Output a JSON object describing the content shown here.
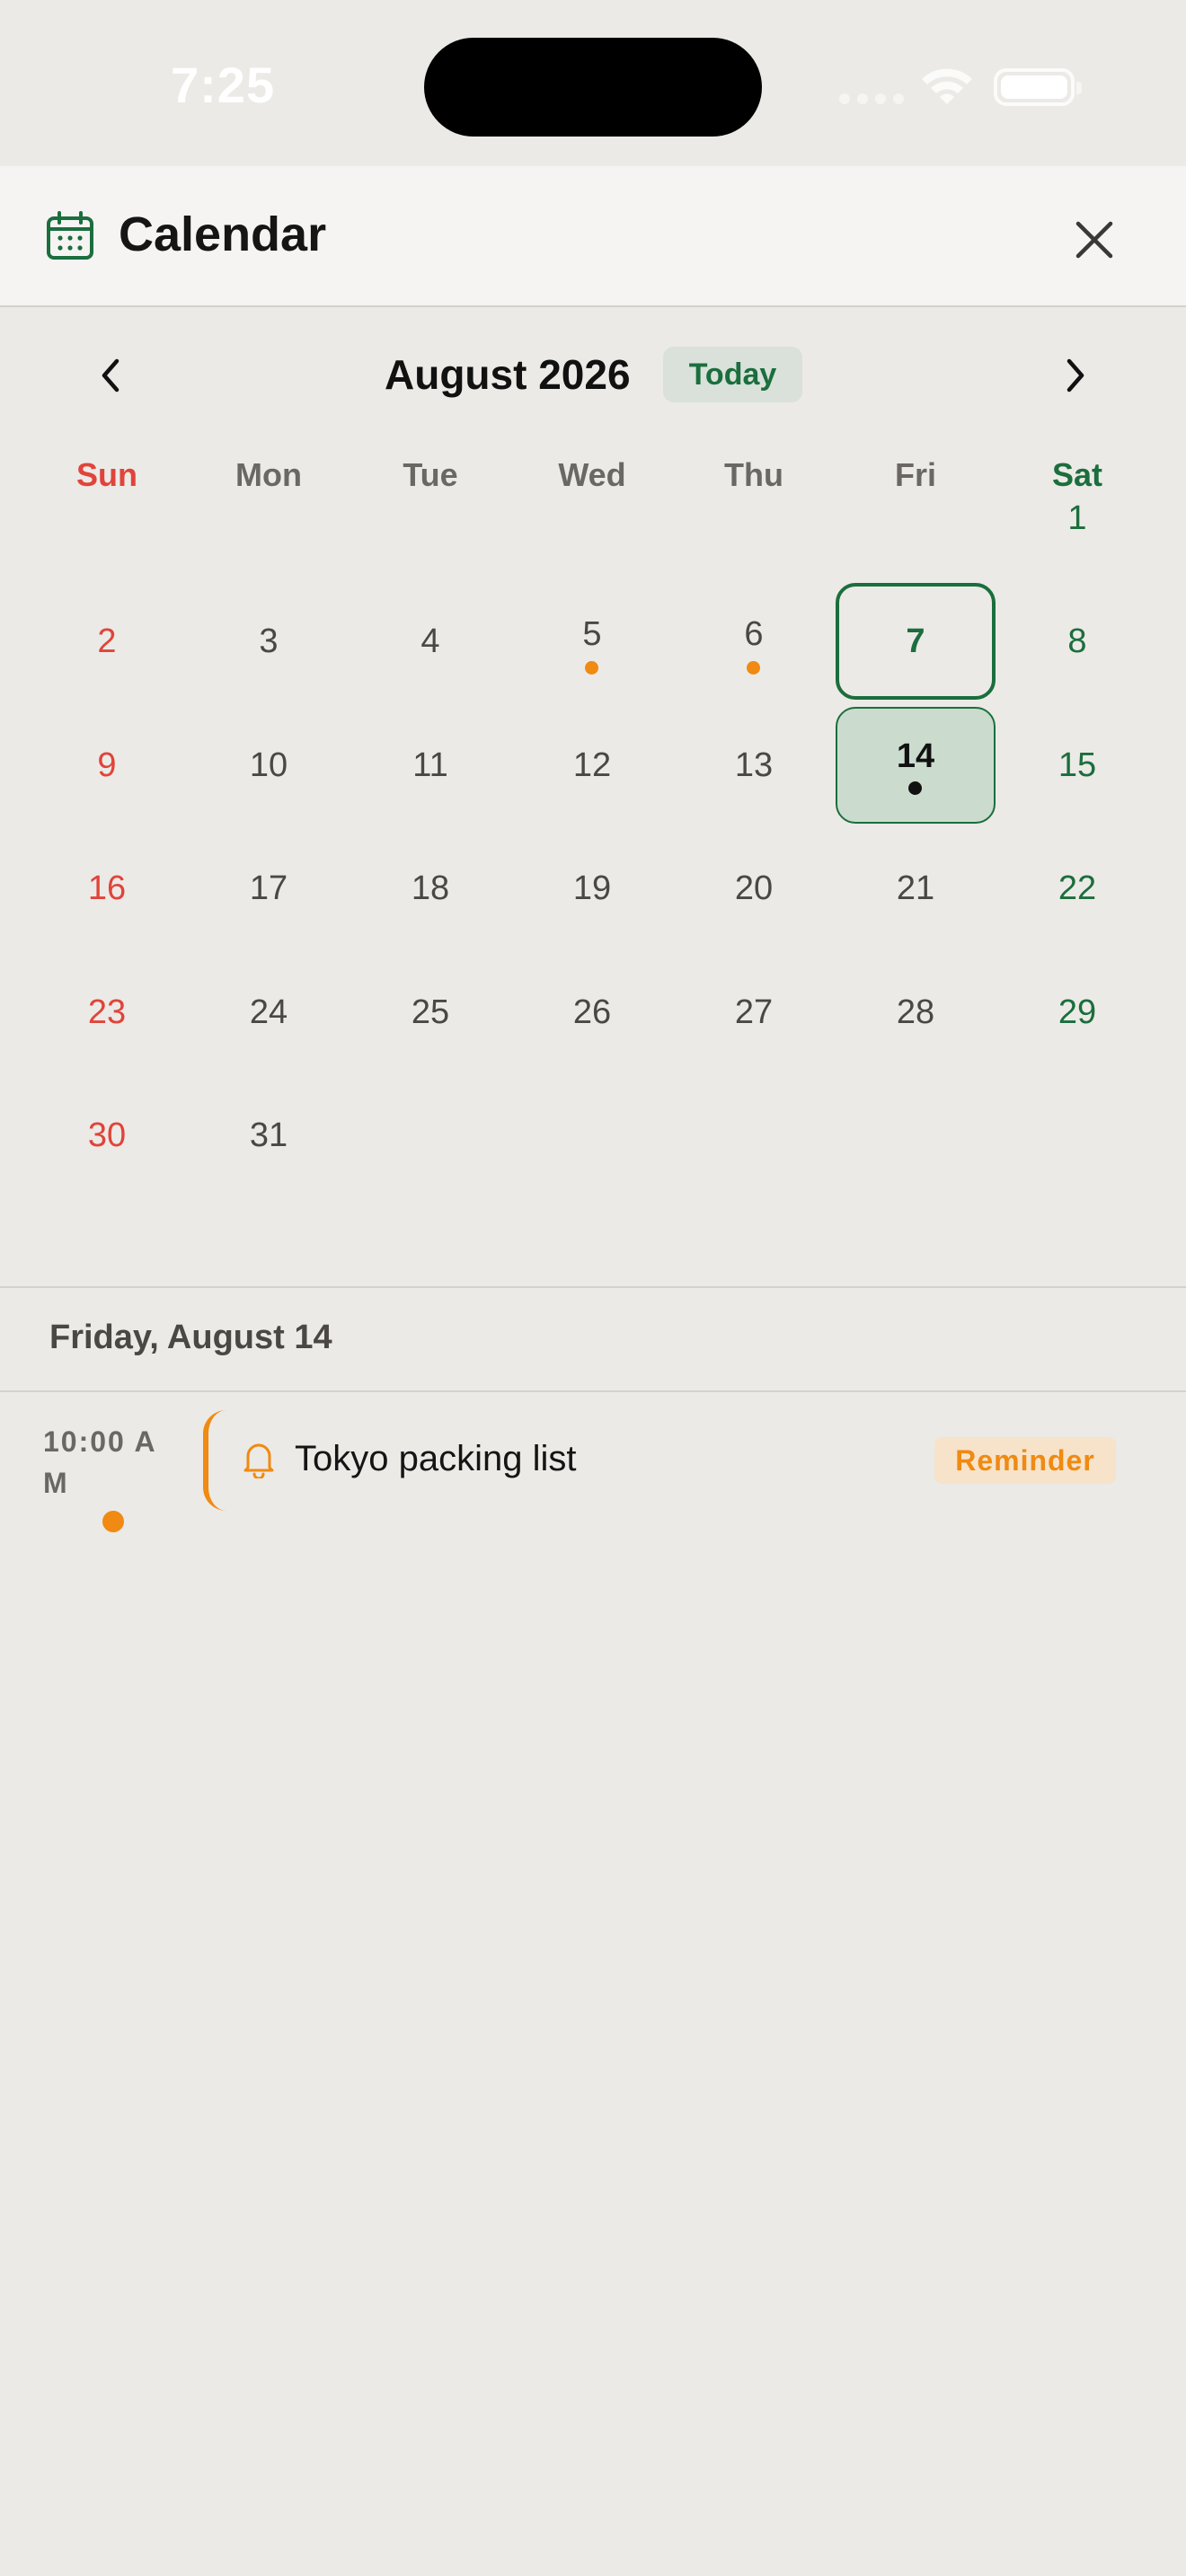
{
  "status_bar": {
    "time": "7:25"
  },
  "header": {
    "title": "Calendar"
  },
  "month_nav": {
    "title": "August 2026",
    "today_label": "Today"
  },
  "weekdays": [
    "Sun",
    "Mon",
    "Tue",
    "Wed",
    "Thu",
    "Fri",
    "Sat"
  ],
  "days": [
    "1",
    "2",
    "3",
    "4",
    "5",
    "6",
    "7",
    "8",
    "9",
    "10",
    "11",
    "12",
    "13",
    "14",
    "15",
    "16",
    "17",
    "18",
    "19",
    "20",
    "21",
    "22",
    "23",
    "24",
    "25",
    "26",
    "27",
    "28",
    "29",
    "30",
    "31"
  ],
  "today_day": "7",
  "selected_day": "14",
  "event_dot_days": [
    "5",
    "6",
    "14"
  ],
  "selected_date_label": "Friday, August 14",
  "events": [
    {
      "time": "10:00 AM",
      "title": "Tokyo packing list",
      "badge": "Reminder"
    }
  ],
  "colors": {
    "accent_green": "#1b6e3d",
    "sunday_red": "#e0443a",
    "reminder_orange": "#f08a12"
  },
  "icons": {
    "header": "calendar-icon",
    "close": "close-icon",
    "prev": "chevron-left-icon",
    "next": "chevron-right-icon",
    "event": "bell-icon"
  }
}
